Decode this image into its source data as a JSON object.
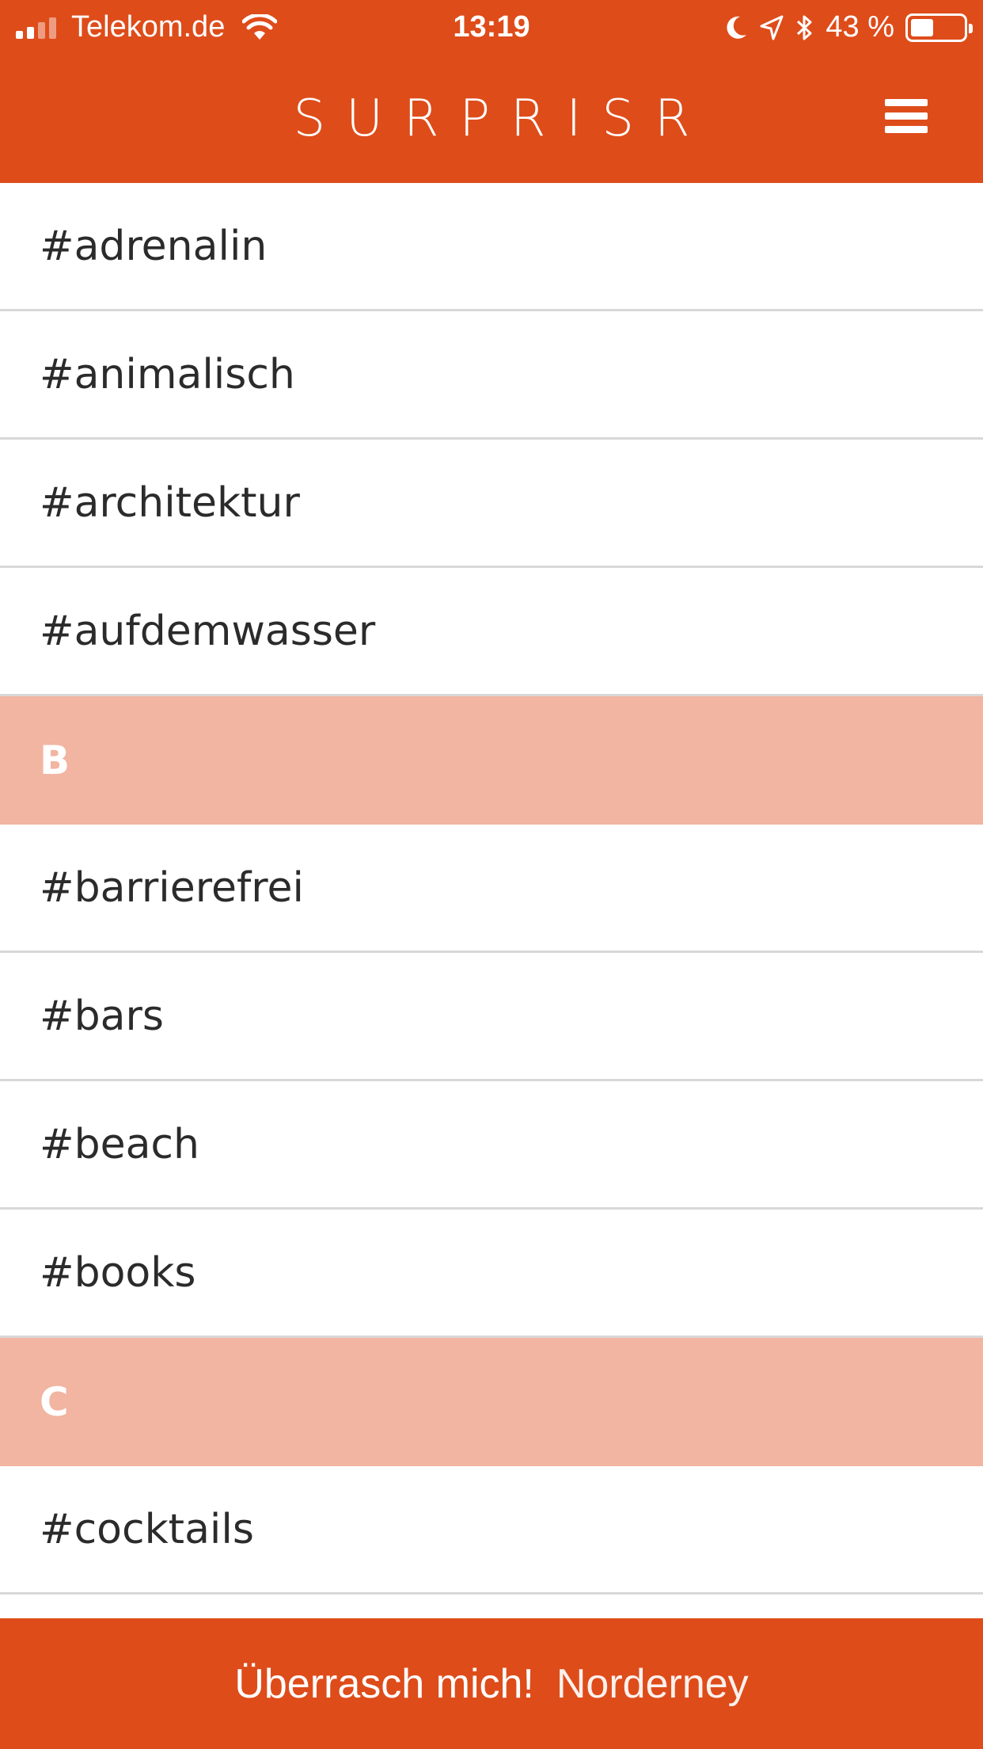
{
  "status_bar": {
    "carrier": "Telekom.de",
    "time": "13:19",
    "battery": "43 %",
    "battery_level": 0.43
  },
  "header": {
    "logo": "SURPRISR"
  },
  "list": [
    {
      "type": "item",
      "label": "#adrenalin"
    },
    {
      "type": "item",
      "label": "#animalisch"
    },
    {
      "type": "item",
      "label": "#architektur"
    },
    {
      "type": "item",
      "label": "#aufdemwasser"
    },
    {
      "type": "section",
      "label": "B"
    },
    {
      "type": "item",
      "label": "#barrierefrei"
    },
    {
      "type": "item",
      "label": "#bars"
    },
    {
      "type": "item",
      "label": "#beach"
    },
    {
      "type": "item",
      "label": "#books"
    },
    {
      "type": "section",
      "label": "C"
    },
    {
      "type": "item",
      "label": "#cocktails"
    },
    {
      "type": "item",
      "label": ""
    }
  ],
  "bottom_bar": {
    "action_label": "Überrasch mich!",
    "location": "Norderney"
  },
  "colors": {
    "accent": "#de4c1a",
    "section_bg": "#f1b5a1"
  }
}
